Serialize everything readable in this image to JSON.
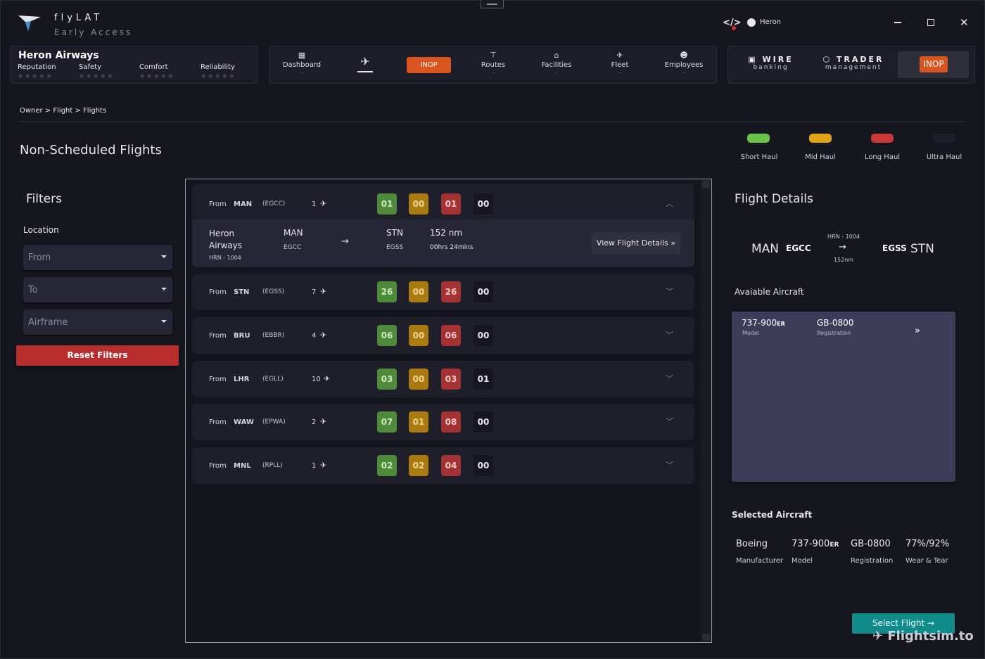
{
  "app": {
    "title": "flyLAT",
    "subtitle": "Early Access",
    "user": "Heron"
  },
  "airline": {
    "name": "Heron Airways",
    "stats": [
      "Reputation",
      "Safety",
      "Comfort",
      "Reliability"
    ]
  },
  "nav": {
    "dashboard": "Dashboard",
    "inop": "INOP",
    "routes": "Routes",
    "facilities": "Facilities",
    "fleet": "Fleet",
    "employees": "Employees"
  },
  "external": {
    "wire_title": "WIRE",
    "wire_sub": "banking",
    "trader_title": "TRADER",
    "trader_sub": "management",
    "third_inop": "INOP"
  },
  "breadcrumb": "Owner > Flight > Flights",
  "page_title": "Non-Scheduled Flights",
  "legend": [
    {
      "label": "Short Haul",
      "color": "#6cc24a"
    },
    {
      "label": "Mid Haul",
      "color": "#e0a315"
    },
    {
      "label": "Long Haul",
      "color": "#c93838"
    },
    {
      "label": "Ultra Haul",
      "color": "#1e1e2a"
    }
  ],
  "filters": {
    "title": "Filters",
    "location_label": "Location",
    "from_placeholder": "From",
    "to_placeholder": "To",
    "airframe_placeholder": "Airframe",
    "reset_label": "Reset Filters"
  },
  "flights": [
    {
      "from_label": "From",
      "code": "MAN",
      "icao": "(EGCC)",
      "count": "1",
      "short": "01",
      "mid": "00",
      "long": "01",
      "ultra": "00"
    },
    {
      "from_label": "From",
      "code": "STN",
      "icao": "(EGSS)",
      "count": "7",
      "short": "26",
      "mid": "00",
      "long": "26",
      "ultra": "00"
    },
    {
      "from_label": "From",
      "code": "BRU",
      "icao": "(EBBR)",
      "count": "4",
      "short": "06",
      "mid": "00",
      "long": "06",
      "ultra": "00"
    },
    {
      "from_label": "From",
      "code": "LHR",
      "icao": "(EGLL)",
      "count": "10",
      "short": "03",
      "mid": "00",
      "long": "03",
      "ultra": "01"
    },
    {
      "from_label": "From",
      "code": "WAW",
      "icao": "(EPWA)",
      "count": "2",
      "short": "07",
      "mid": "01",
      "long": "08",
      "ultra": "00"
    },
    {
      "from_label": "From",
      "code": "MNL",
      "icao": "(RPLL)",
      "count": "1",
      "short": "02",
      "mid": "02",
      "long": "04",
      "ultra": "00"
    }
  ],
  "expanded_flight": {
    "airline_line1": "Heron",
    "airline_line2": "Airways",
    "flight_no": "HRN - 1004",
    "origin": "MAN",
    "origin_icao": "EGCC",
    "dest": "STN",
    "dest_icao": "EGSS",
    "distance": "152 nm",
    "duration": "00hrs 24mins",
    "button": "View Flight Details"
  },
  "details": {
    "title": "Flight Details",
    "origin": "MAN",
    "origin_icao": "EGCC",
    "flight_no": "HRN - 1004",
    "distance": "152nm",
    "dest_icao": "EGSS",
    "dest": "STN",
    "available_label": "Avaiable Aircraft",
    "aircraft_model": "737-900",
    "aircraft_model_suffix": "ER",
    "model_label": "Model",
    "aircraft_reg": "GB-0800",
    "reg_label": "Registration"
  },
  "selected": {
    "label": "Selected Aircraft",
    "manufacturer": "Boeing",
    "manufacturer_label": "Manufacturer",
    "model": "737-900",
    "model_suffix": "ER",
    "model_label": "Model",
    "registration": "GB-0800",
    "registration_label": "Registration",
    "wear": "77%/92%",
    "wear_label": "Wear & Tear",
    "button": "Select Flight"
  },
  "watermark": "Flightsim.to"
}
